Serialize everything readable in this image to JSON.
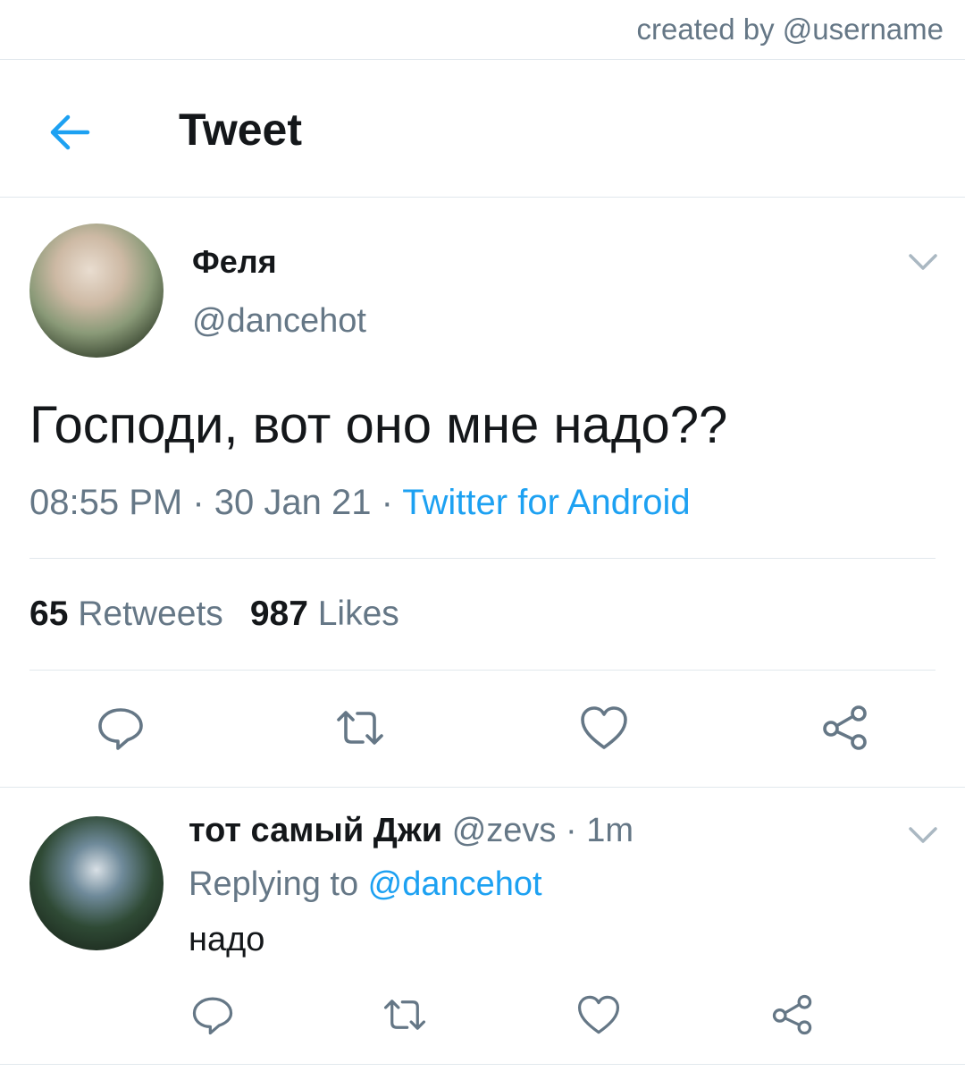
{
  "credit": "created by @username",
  "header": {
    "title": "Tweet"
  },
  "tweet": {
    "author_name": "Феля",
    "author_handle": "@dancehot",
    "text": "Господи, вот оно мне надо??",
    "time": "08:55 PM",
    "date": "30 Jan 21",
    "separator": " · ",
    "source": "Twitter for Android",
    "retweets_count": "65",
    "retweets_label": "Retweets",
    "likes_count": "987",
    "likes_label": "Likes"
  },
  "reply": {
    "author_name": "тот самый Джи",
    "author_handle": "@zevs",
    "separator": " · ",
    "time": "1m",
    "replying_label": "Replying to ",
    "replying_to": "@dancehot",
    "text": "надо"
  },
  "icons": {
    "back": "arrow-left-icon",
    "more": "chevron-down-icon",
    "reply": "comment-bubble-icon",
    "retweet": "retweet-icon",
    "like": "heart-icon",
    "share": "share-icon"
  },
  "colors": {
    "accent": "#1da1f2",
    "text": "#14171a",
    "muted": "#657786",
    "divider": "#e1e8ed"
  }
}
